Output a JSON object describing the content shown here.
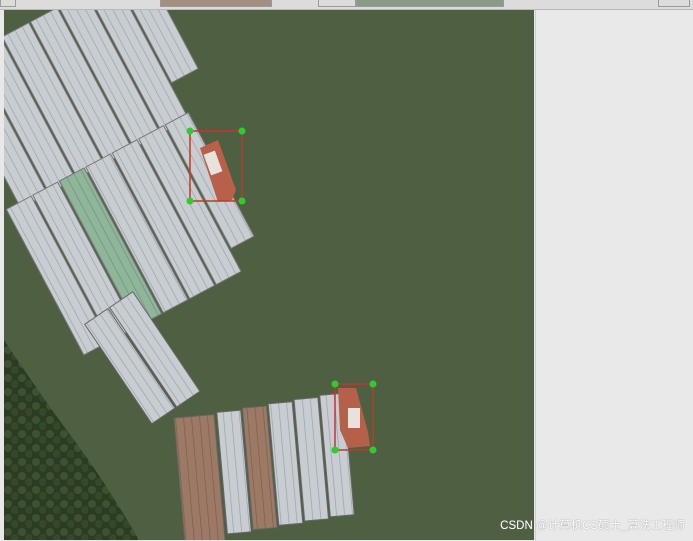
{
  "viewer": {
    "image_semantic": "aerial-satellite-harbor-barges",
    "annotation_box_color": "#c0392b",
    "annotation_handle_color": "#2ecc2e",
    "detections": [
      {
        "label": "",
        "object": "tugboat"
      },
      {
        "label": "",
        "object": "tugboat"
      }
    ]
  },
  "watermark": {
    "text": "CSDN @计算机CS硕士_算法工程师"
  },
  "colors": {
    "water": "#4f5f42",
    "panel": "#e9e9e9"
  }
}
